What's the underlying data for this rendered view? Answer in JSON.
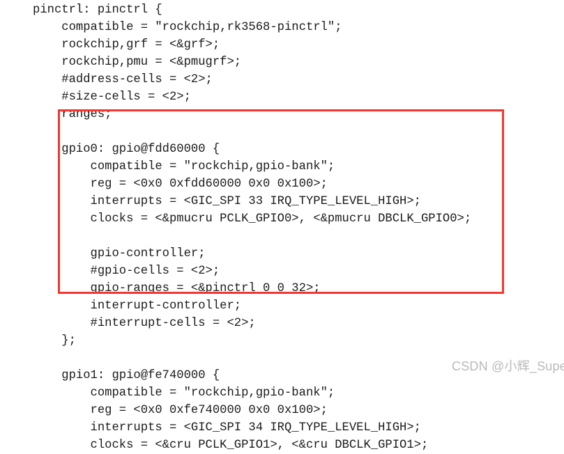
{
  "document": {
    "kind": "device-tree-source-snippet",
    "language": "dts",
    "background_color": "#ffffff",
    "text_color": "#1b1b1b",
    "lines": [
      "pinctrl: pinctrl {",
      "    compatible = \"rockchip,rk3568-pinctrl\";",
      "    rockchip,grf = <&grf>;",
      "    rockchip,pmu = <&pmugrf>;",
      "    #address-cells = <2>;",
      "    #size-cells = <2>;",
      "    ranges;",
      "",
      "    gpio0: gpio@fdd60000 {",
      "        compatible = \"rockchip,gpio-bank\";",
      "        reg = <0x0 0xfdd60000 0x0 0x100>;",
      "        interrupts = <GIC_SPI 33 IRQ_TYPE_LEVEL_HIGH>;",
      "        clocks = <&pmucru PCLK_GPIO0>, <&pmucru DBCLK_GPIO0>;",
      "",
      "        gpio-controller;",
      "        #gpio-cells = <2>;",
      "        gpio-ranges = <&pinctrl 0 0 32>;",
      "        interrupt-controller;",
      "        #interrupt-cells = <2>;",
      "    };",
      "",
      "    gpio1: gpio@fe740000 {",
      "        compatible = \"rockchip,gpio-bank\";",
      "        reg = <0x0 0xfe740000 0x0 0x100>;",
      "        interrupts = <GIC_SPI 34 IRQ_TYPE_LEVEL_HIGH>;",
      "        clocks = <&cru PCLK_GPIO1>, <&cru DBCLK_GPIO1>;"
    ]
  },
  "annotation": {
    "highlight_box": {
      "color": "#f5352f",
      "border_width_px": 3,
      "covers_lines": [
        "gpio0: gpio@fdd60000 {",
        "    compatible = \"rockchip,gpio-bank\";",
        "    reg = <0x0 0xfdd60000 0x0 0x100>;",
        "    interrupts = <GIC_SPI 33 IRQ_TYPE_LEVEL_HIGH>;",
        "    clocks = <&pmucru PCLK_GPIO0>, <&pmucru DBCLK_GPIO0>;",
        "",
        "    gpio-controller;",
        "    #gpio-cells = <2>;",
        "    gpio-ranges = <&pinctrl 0 0 32>;",
        "    interrupt-controller;",
        "    #interrupt-cells = <2>;",
        "};"
      ]
    }
  },
  "watermark": {
    "text": "CSDN @小辉_Super",
    "color": "#b9b9b9"
  }
}
